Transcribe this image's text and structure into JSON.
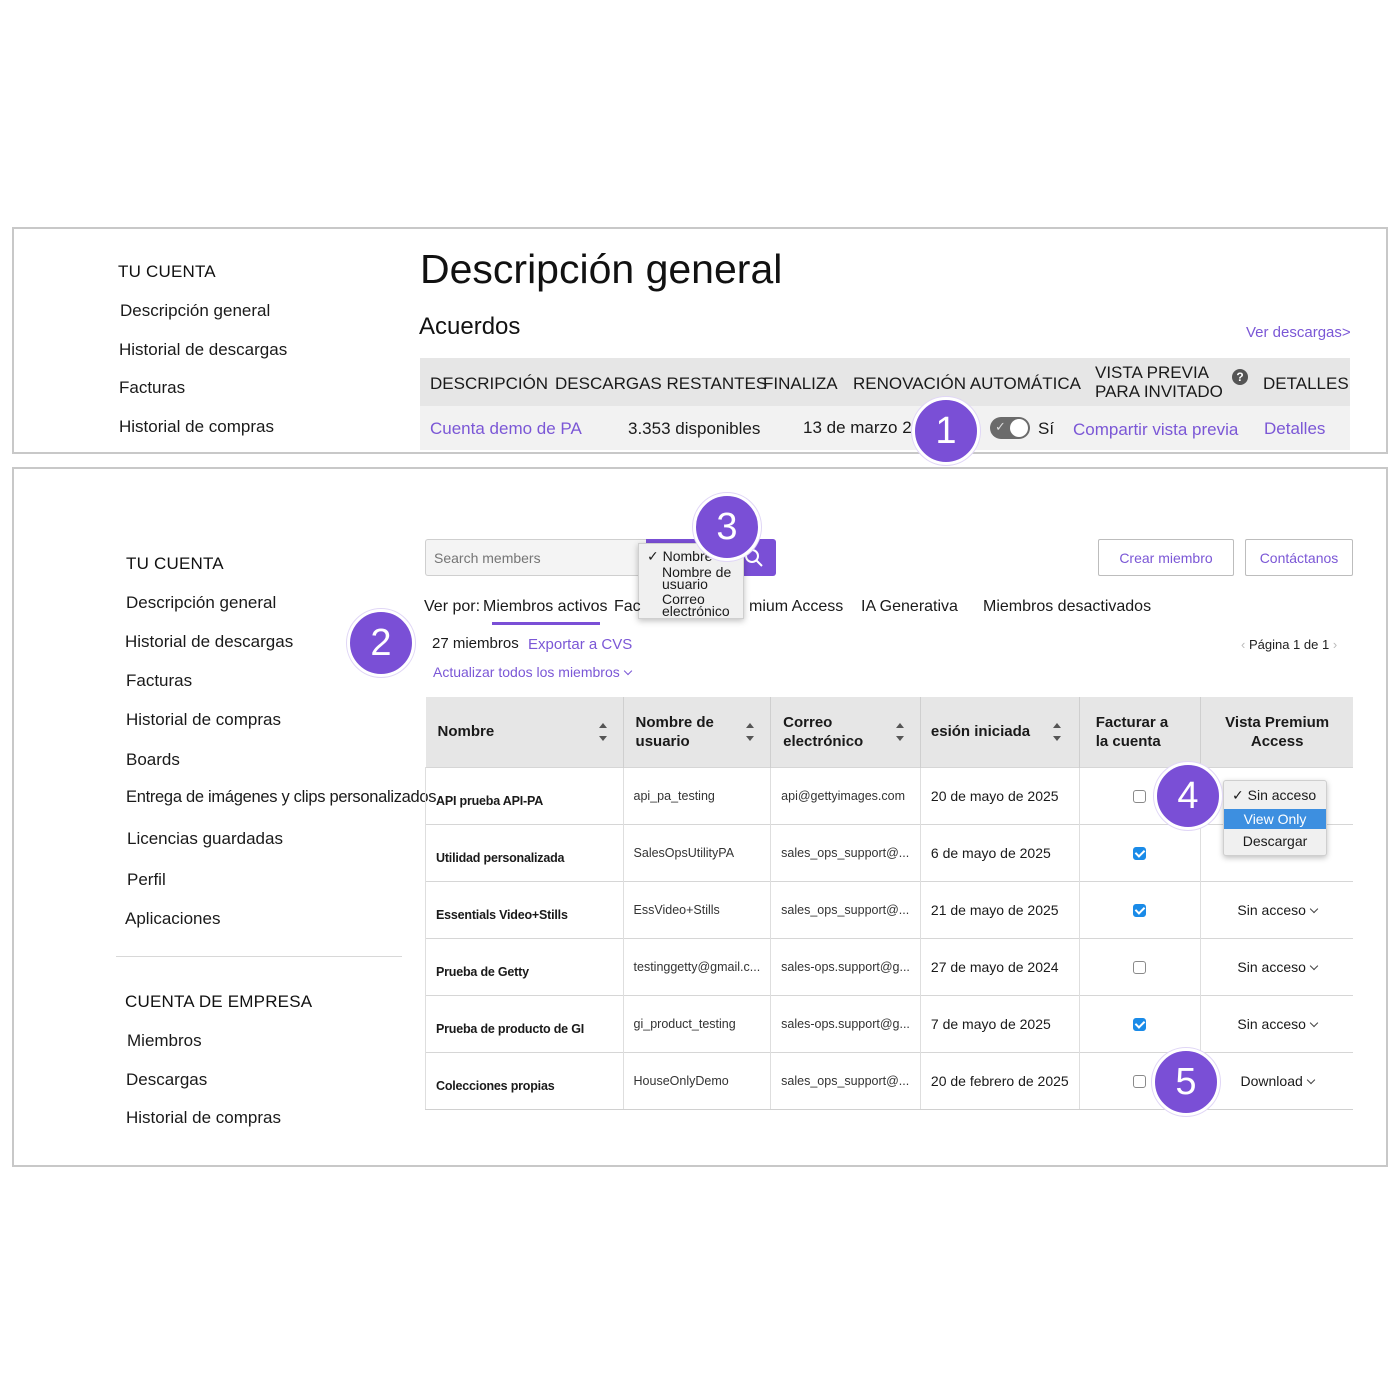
{
  "top": {
    "sidebar": {
      "heading": "TU CUENTA",
      "items": [
        "Descripción general",
        "Historial de descargas",
        "Facturas",
        "Historial de compras"
      ]
    },
    "page_title": "Descripción general",
    "section_title": "Acuerdos",
    "view_downloads_link": "Ver descargas>",
    "table_headers": {
      "description": "DESCRIPCIÓN",
      "remaining": "DESCARGAS RESTANTES",
      "ends": "FINALIZA",
      "auto_renew": "RENOVACIÓN AUTOMÁTICA",
      "guest_preview_line1": "VISTA PREVIA",
      "guest_preview_line2": "PARA INVITADO",
      "details": "DETALLES"
    },
    "row": {
      "account": "Cuenta demo de PA",
      "remaining": "3.353 disponibles",
      "ends": "13 de marzo 2026",
      "auto_renew_label": "Sí",
      "share_preview": "Compartir vista previa",
      "details": "Detalles"
    }
  },
  "bottom": {
    "sidebar": {
      "heading": "TU CUENTA",
      "items": [
        "Descripción general",
        "Historial de descargas",
        "Facturas",
        "Historial de compras",
        "Boards",
        "Entrega de imágenes y clips personalizados",
        "Licencias guardadas",
        "Perfil",
        "Aplicaciones"
      ],
      "company_heading": "CUENTA DE EMPRESA",
      "company_items": [
        "Miembros",
        "Descargas",
        "Historial de compras"
      ]
    },
    "search": {
      "placeholder": "Search members",
      "filter_options": [
        "Nombre",
        "Nombre de usuario",
        "Correo electrónico"
      ]
    },
    "buttons": {
      "create_member": "Crear miembro",
      "contact_us": "Contáctanos"
    },
    "view_by": {
      "label": "Ver por:",
      "tab_active": "Miembros activos",
      "tab_fac": "Fac",
      "tab_premium": "mium Access",
      "tab_ai": "IA Generativa",
      "tab_deactivated": "Miembros desactivados"
    },
    "member_count": "27 miembros",
    "export_link": "Exportar a CVS",
    "update_all": "Actualizar todos los miembros",
    "pagination": "Página 1 de 1",
    "columns": {
      "name": "Nombre",
      "username_l1": "Nombre de",
      "username_l2": "usuario",
      "email_l1": "Correo",
      "email_l2": "electrónico",
      "session": "esión iniciada",
      "bill_l1": "Facturar a",
      "bill_l2": "la cuenta",
      "premium_l1": "Vista Premium",
      "premium_l2": "Access"
    },
    "rows": [
      {
        "name": "API prueba API-PA",
        "username": "api_pa_testing",
        "email": "api@gettyimages.com",
        "session": "20 de mayo de 2025",
        "billed": false,
        "access": ""
      },
      {
        "name": "Utilidad personalizada",
        "username": "SalesOpsUtilityPA",
        "email": "sales_ops_support@...",
        "session": "6 de mayo de 2025",
        "billed": true,
        "access": ""
      },
      {
        "name": "Essentials Video+Stills",
        "username": "EssVideo+Stills",
        "email": "sales_ops_support@...",
        "session": "21 de mayo de 2025",
        "billed": true,
        "access": "Sin acceso"
      },
      {
        "name": "Prueba de Getty",
        "username": "testinggetty@gmail.c...",
        "email": "sales-ops.support@g...",
        "session": "27 de mayo de 2024",
        "billed": false,
        "access": "Sin acceso"
      },
      {
        "name": "Prueba de producto de GI",
        "username": "gi_product_testing",
        "email": "sales-ops.support@g...",
        "session": "7 de mayo de 2025",
        "billed": true,
        "access": "Sin acceso"
      },
      {
        "name": "Colecciones propias",
        "username": "HouseOnlyDemo",
        "email": "sales_ops_support@...",
        "session": "20 de febrero de 2025",
        "billed": false,
        "access": "Download"
      }
    ],
    "access_menu": [
      "Sin acceso",
      "View Only",
      "Descargar"
    ]
  },
  "badges": [
    "1",
    "2",
    "3",
    "4",
    "5"
  ],
  "colors": {
    "accent": "#7b57d6",
    "badge": "#7a4fd6",
    "checkbox": "#1a8be8",
    "highlight": "#3d8fe0"
  }
}
